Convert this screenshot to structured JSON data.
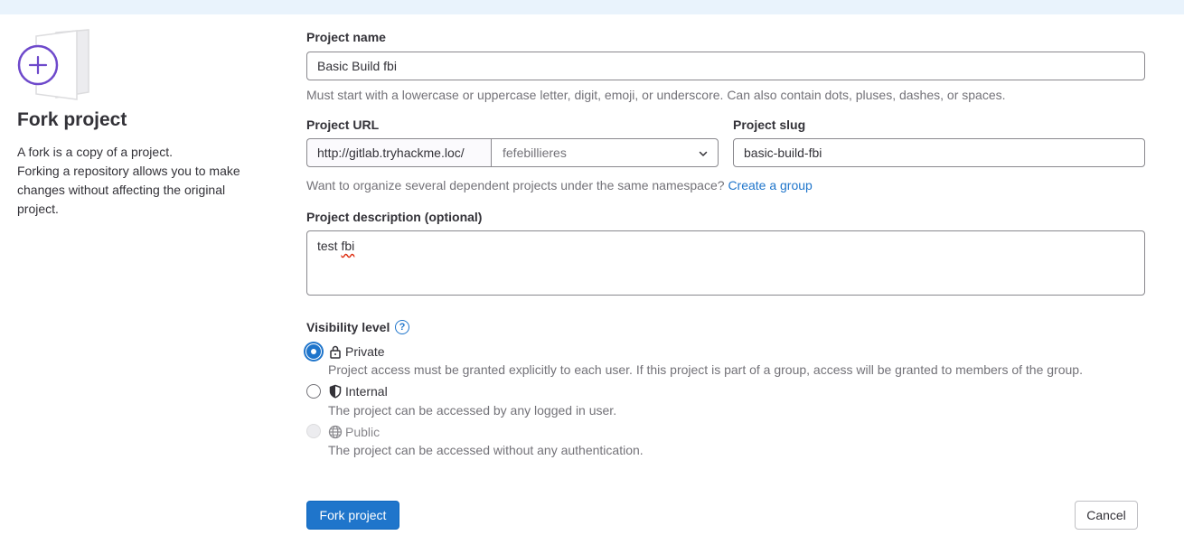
{
  "left": {
    "title": "Fork project",
    "description_line1": "A fork is a copy of a project.",
    "description_line2": "Forking a repository allows you to make changes without affecting the original project."
  },
  "project_name": {
    "label": "Project name",
    "value": "Basic Build fbi",
    "help": "Must start with a lowercase or uppercase letter, digit, emoji, or underscore. Can also contain dots, pluses, dashes, or spaces."
  },
  "project_url": {
    "label": "Project URL",
    "prefix": "http://gitlab.tryhackme.loc/",
    "namespace": "fefebillieres"
  },
  "project_slug": {
    "label": "Project slug",
    "value": "basic-build-fbi"
  },
  "group_hint": {
    "text": "Want to organize several dependent projects under the same namespace?",
    "link": "Create a group"
  },
  "project_description": {
    "label": "Project description (optional)",
    "value_word1": "test",
    "value_word2": "fbi"
  },
  "visibility": {
    "label": "Visibility level",
    "help_glyph": "?",
    "options": [
      {
        "label": "Private",
        "icon": "lock-icon",
        "selected": true,
        "disabled": false,
        "description": "Project access must be granted explicitly to each user. If this project is part of a group, access will be granted to members of the group."
      },
      {
        "label": "Internal",
        "icon": "shield-icon",
        "selected": false,
        "disabled": false,
        "description": "The project can be accessed by any logged in user."
      },
      {
        "label": "Public",
        "icon": "globe-icon",
        "selected": false,
        "disabled": true,
        "description": "The project can be accessed without any authentication."
      }
    ]
  },
  "actions": {
    "submit": "Fork project",
    "cancel": "Cancel"
  },
  "colors": {
    "primary": "#1f75cb",
    "illustration_purple": "#6e49cb",
    "header_strip": "#e9f3fc"
  }
}
